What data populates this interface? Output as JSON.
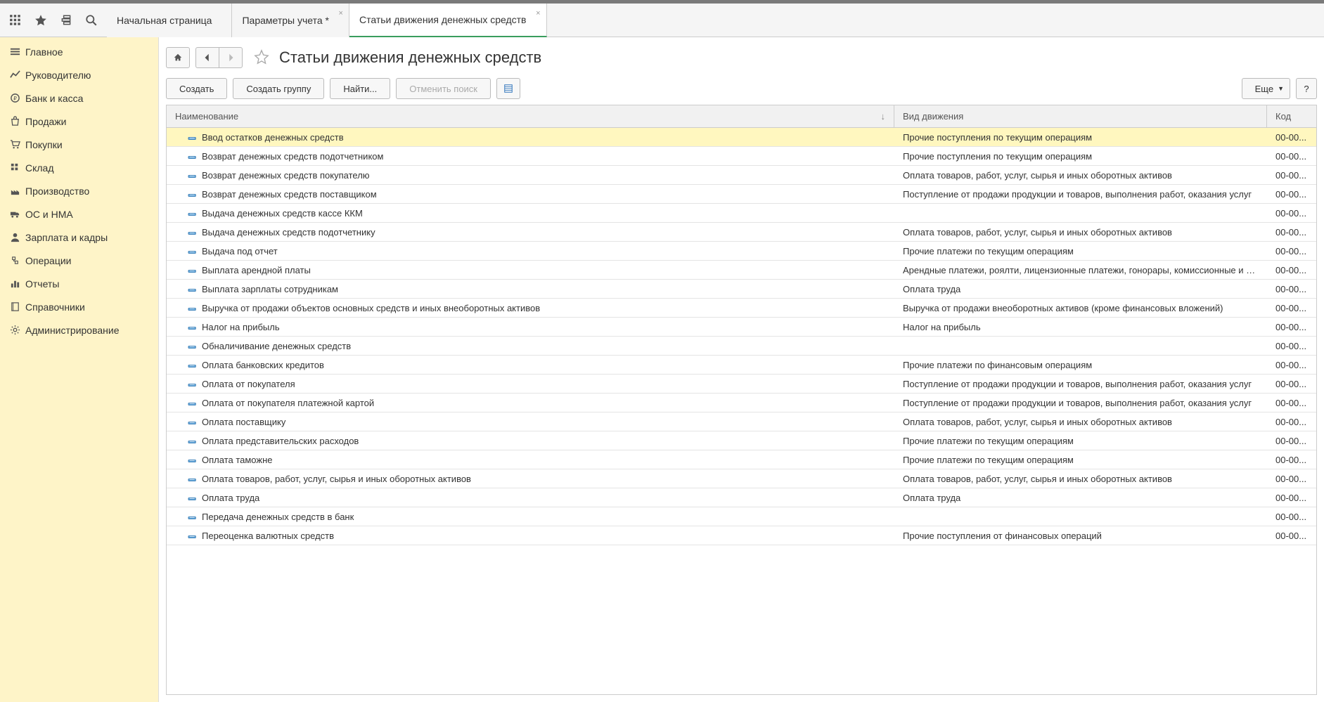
{
  "tabs": [
    {
      "label": "Начальная страница",
      "closable": false,
      "active": false
    },
    {
      "label": "Параметры учета *",
      "closable": true,
      "active": false
    },
    {
      "label": "Статьи движения денежных средств",
      "closable": true,
      "active": true
    }
  ],
  "sidebar": {
    "items": [
      {
        "id": "main",
        "label": "Главное",
        "icon": "menu-icon"
      },
      {
        "id": "manager",
        "label": "Руководителю",
        "icon": "chart-icon"
      },
      {
        "id": "bank",
        "label": "Банк и касса",
        "icon": "coin-icon"
      },
      {
        "id": "sales",
        "label": "Продажи",
        "icon": "bag-icon"
      },
      {
        "id": "purchases",
        "label": "Покупки",
        "icon": "cart-icon"
      },
      {
        "id": "warehouse",
        "label": "Склад",
        "icon": "grid-icon"
      },
      {
        "id": "production",
        "label": "Производство",
        "icon": "factory-icon"
      },
      {
        "id": "os",
        "label": "ОС и НМА",
        "icon": "truck-icon"
      },
      {
        "id": "hr",
        "label": "Зарплата и кадры",
        "icon": "person-icon"
      },
      {
        "id": "operations",
        "label": "Операции",
        "icon": "ops-icon"
      },
      {
        "id": "reports",
        "label": "Отчеты",
        "icon": "bars-icon"
      },
      {
        "id": "refs",
        "label": "Справочники",
        "icon": "book-icon"
      },
      {
        "id": "admin",
        "label": "Администрирование",
        "icon": "gear-icon"
      }
    ]
  },
  "page": {
    "title": "Статьи движения денежных средств"
  },
  "toolbar": {
    "create_label": "Создать",
    "create_group_label": "Создать группу",
    "find_label": "Найти...",
    "cancel_search_label": "Отменить поиск",
    "more_label": "Еще",
    "help_label": "?"
  },
  "table": {
    "columns": {
      "name": "Наименование",
      "type": "Вид движения",
      "code": "Код"
    },
    "rows": [
      {
        "name": "Ввод остатков денежных средств",
        "type": "Прочие поступления по текущим операциям",
        "code": "00-00...",
        "selected": true
      },
      {
        "name": "Возврат денежных средств подотчетником",
        "type": "Прочие поступления по текущим операциям",
        "code": "00-00..."
      },
      {
        "name": "Возврат денежных средств покупателю",
        "type": "Оплата товаров, работ, услуг, сырья и иных оборотных активов",
        "code": "00-00..."
      },
      {
        "name": "Возврат денежных средств поставщиком",
        "type": "Поступление от продажи продукции и товаров, выполнения работ, оказания услуг",
        "code": "00-00..."
      },
      {
        "name": "Выдача денежных средств кассе ККМ",
        "type": "",
        "code": "00-00..."
      },
      {
        "name": "Выдача денежных средств подотчетнику",
        "type": "Оплата товаров, работ, услуг, сырья и иных оборотных активов",
        "code": "00-00..."
      },
      {
        "name": "Выдача под отчет",
        "type": "Прочие платежи по текущим операциям",
        "code": "00-00..."
      },
      {
        "name": "Выплата арендной платы",
        "type": "Арендные платежи, роялти, лицензионные платежи, гонорары, комиссионные и ин...",
        "code": "00-00..."
      },
      {
        "name": "Выплата зарплаты сотрудникам",
        "type": "Оплата труда",
        "code": "00-00..."
      },
      {
        "name": "Выручка от продажи объектов основных средств и иных внеоборотных активов",
        "type": "Выручка от продажи внеоборотных активов (кроме финансовых вложений)",
        "code": "00-00..."
      },
      {
        "name": "Налог на прибыль",
        "type": "Налог на прибыль",
        "code": "00-00..."
      },
      {
        "name": "Обналичивание денежных средств",
        "type": "",
        "code": "00-00..."
      },
      {
        "name": "Оплата банковских кредитов",
        "type": "Прочие платежи по финансовым операциям",
        "code": "00-00..."
      },
      {
        "name": "Оплата от покупателя",
        "type": "Поступление от продажи продукции и товаров, выполнения работ, оказания услуг",
        "code": "00-00..."
      },
      {
        "name": "Оплата от покупателя платежной картой",
        "type": "Поступление от продажи продукции и товаров, выполнения работ, оказания услуг",
        "code": "00-00..."
      },
      {
        "name": "Оплата поставщику",
        "type": "Оплата товаров, работ, услуг, сырья и иных оборотных активов",
        "code": "00-00..."
      },
      {
        "name": "Оплата представительских расходов",
        "type": "Прочие платежи по текущим операциям",
        "code": "00-00..."
      },
      {
        "name": "Оплата таможне",
        "type": "Прочие платежи по текущим операциям",
        "code": "00-00..."
      },
      {
        "name": "Оплата товаров, работ, услуг, сырья и иных оборотных активов",
        "type": "Оплата товаров, работ, услуг, сырья и иных оборотных активов",
        "code": "00-00..."
      },
      {
        "name": "Оплата труда",
        "type": "Оплата труда",
        "code": "00-00..."
      },
      {
        "name": "Передача денежных средств в банк",
        "type": "",
        "code": "00-00..."
      },
      {
        "name": "Переоценка валютных средств",
        "type": "Прочие поступления от финансовых операций",
        "code": "00-00..."
      }
    ]
  }
}
